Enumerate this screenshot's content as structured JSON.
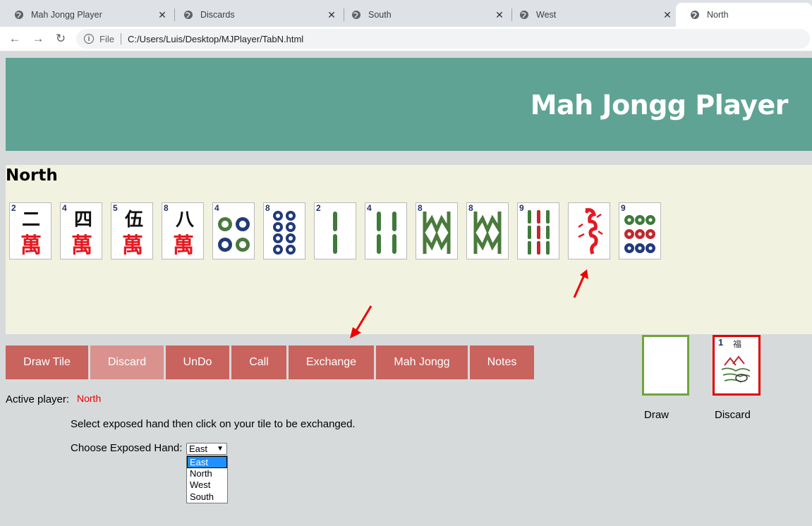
{
  "browser": {
    "tabs": [
      {
        "label": "Mah Jongg Player",
        "active": false
      },
      {
        "label": "Discards",
        "active": false
      },
      {
        "label": "South",
        "active": false
      },
      {
        "label": "West",
        "active": false
      },
      {
        "label": "North",
        "active": true
      }
    ],
    "omnibox": {
      "scheme_label": "File",
      "url": "C:/Users/Luis/Desktop/MJPlayer/TabN.html"
    }
  },
  "page": {
    "title": "Mah Jongg Player",
    "hand_title": "North",
    "tiles": [
      {
        "suit": "character",
        "number": "2",
        "icon": "character-2-tile"
      },
      {
        "suit": "character",
        "number": "4",
        "icon": "character-4-tile"
      },
      {
        "suit": "character",
        "number": "5",
        "icon": "character-5-tile"
      },
      {
        "suit": "character",
        "number": "8",
        "icon": "character-8-tile"
      },
      {
        "suit": "dot",
        "number": "4",
        "icon": "dot-4-tile"
      },
      {
        "suit": "dot",
        "number": "8",
        "icon": "dot-8-tile"
      },
      {
        "suit": "bam",
        "number": "2",
        "icon": "bam-2-tile"
      },
      {
        "suit": "bam",
        "number": "4",
        "icon": "bam-4-tile"
      },
      {
        "suit": "bam",
        "number": "8",
        "icon": "bam-8-tile"
      },
      {
        "suit": "bam",
        "number": "8",
        "icon": "bam-8-tile"
      },
      {
        "suit": "bam",
        "number": "9",
        "icon": "bam-9-tile"
      },
      {
        "suit": "dragon",
        "number": "",
        "icon": "red-dragon-tile"
      },
      {
        "suit": "dot",
        "number": "9",
        "icon": "dot-9-tile"
      }
    ],
    "buttons": {
      "draw": "Draw Tile",
      "discard": "Discard",
      "undo": "UnDo",
      "call": "Call",
      "exchange": "Exchange",
      "mahjongg": "Mah Jongg",
      "notes": "Notes"
    },
    "active_player_label": "Active player:",
    "active_player": "North",
    "instruction": "Select exposed hand then click on your tile to be exchanged.",
    "choose_label": "Choose Exposed Hand:",
    "select_value": "East",
    "select_options": [
      "East",
      "North",
      "West",
      "South"
    ],
    "draw_label": "Draw",
    "discard_label": "Discard",
    "discard_tile": {
      "number": "1",
      "icon": "bird-1-tile"
    },
    "colors": {
      "banner": "#5fa394",
      "button": "#c9635e",
      "draw_border": "#6ea63a",
      "discard_border": "#e00000",
      "active_player": "#ee0000"
    }
  }
}
